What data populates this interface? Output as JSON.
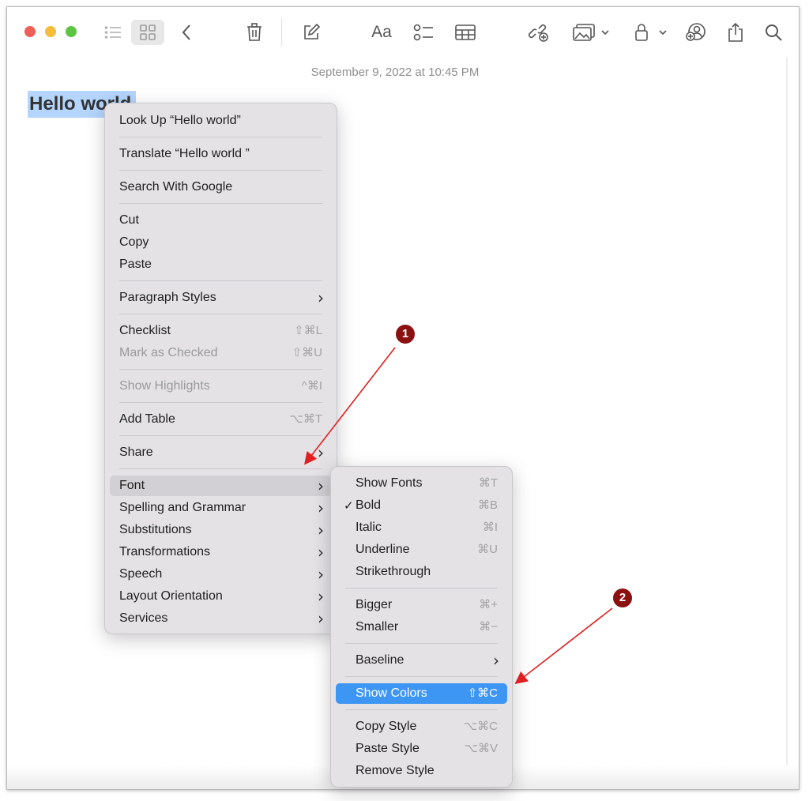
{
  "toolbar": {
    "traffic": {
      "close": "#ed5f57",
      "minimize": "#f5bd3a",
      "maximize": "#5ec444"
    },
    "icons": [
      "list-view-icon",
      "gallery-view-icon",
      "back-icon",
      "trash-icon",
      "compose-icon",
      "format-text-icon",
      "checklist-icon",
      "table-icon",
      "collaborate-icon",
      "media-icon",
      "lock-icon",
      "share-note-icon",
      "export-icon",
      "search-icon"
    ],
    "format_label": "Aa"
  },
  "note": {
    "date": "September 9, 2022 at 10:45 PM",
    "title": "Hello world"
  },
  "context_menu": {
    "look_up": "Look Up “Hello world”",
    "translate": "Translate “Hello world ”",
    "search_google": "Search With Google",
    "cut": "Cut",
    "copy": "Copy",
    "paste": "Paste",
    "paragraph_styles": "Paragraph Styles",
    "checklist": "Checklist",
    "checklist_sc": "⇧⌘L",
    "mark_checked": "Mark as Checked",
    "mark_checked_sc": "⇧⌘U",
    "show_highlights": "Show Highlights",
    "show_highlights_sc": "^⌘I",
    "add_table": "Add Table",
    "add_table_sc": "⌥⌘T",
    "share": "Share",
    "font": "Font",
    "spelling": "Spelling and Grammar",
    "substitutions": "Substitutions",
    "transformations": "Transformations",
    "speech": "Speech",
    "layout": "Layout Orientation",
    "services": "Services"
  },
  "font_menu": {
    "show_fonts": "Show Fonts",
    "show_fonts_sc": "⌘T",
    "bold": "Bold",
    "bold_sc": "⌘B",
    "italic": "Italic",
    "italic_sc": "⌘I",
    "underline": "Underline",
    "underline_sc": "⌘U",
    "strikethrough": "Strikethrough",
    "bigger": "Bigger",
    "bigger_sc": "⌘+",
    "smaller": "Smaller",
    "smaller_sc": "⌘−",
    "baseline": "Baseline",
    "show_colors": "Show Colors",
    "show_colors_sc": "⇧⌘C",
    "copy_style": "Copy Style",
    "copy_style_sc": "⌥⌘C",
    "paste_style": "Paste Style",
    "paste_style_sc": "⌥⌘V",
    "remove_style": "Remove Style"
  },
  "annotations": {
    "badge1": "1",
    "badge2": "2",
    "color": "#8b1010"
  },
  "colors": {
    "selection": "#b4d5fe",
    "menu_highlight": "#3d95f4"
  }
}
